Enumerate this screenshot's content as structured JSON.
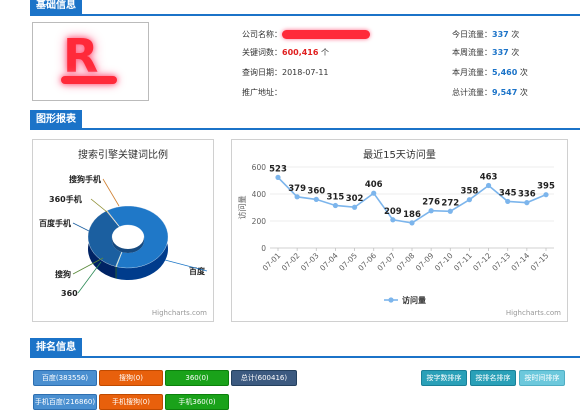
{
  "sections": {
    "basic_info": "基础信息",
    "charts": "图形报表",
    "ranking": "排名信息"
  },
  "info": {
    "company_label": "公司名称：",
    "keyword_label": "关键词数：",
    "keyword_value": "600,416",
    "keyword_unit": " 个",
    "query_date_label": "查询日期：",
    "query_date_value": "2018-07-11",
    "promo_label": "推广地址：",
    "today_label": "今日流量：",
    "today_value": "337",
    "week_label": "本周流量：",
    "week_value": "337",
    "month_label": "本月流量：",
    "month_value": "5,460",
    "total_label": "总计流量：",
    "total_value": "9,547",
    "unit": " 次"
  },
  "pie_panel": {
    "title": "搜索引擎关键词比例",
    "credit": "Highcharts.com"
  },
  "line_panel": {
    "title": "最近15天访问量",
    "credit": "Highcharts.com"
  },
  "chart_data": [
    {
      "type": "pie",
      "title": "搜索引擎关键词比例",
      "categories": [
        "百度",
        "搜狗",
        "360",
        "百度手机",
        "360手机",
        "搜狗手机"
      ],
      "values": [
        383556,
        0,
        0,
        216860,
        0,
        0
      ],
      "colors": [
        "#1f78c8",
        "#5a8a3a",
        "#2e8b57",
        "#1b5fa0",
        "#8a8a2a",
        "#d08030"
      ]
    },
    {
      "type": "line",
      "title": "最近15天访问量",
      "ylabel": "访问量",
      "ylim": [
        0,
        600
      ],
      "yticks": [
        0,
        200,
        400,
        600
      ],
      "grid": true,
      "legend": "bottom",
      "x": [
        "07-01",
        "07-02",
        "07-03",
        "07-04",
        "07-05",
        "07-06",
        "07-07",
        "07-08",
        "07-09",
        "07-10",
        "07-11",
        "07-12",
        "07-13",
        "07-14",
        "07-15"
      ],
      "series": [
        {
          "name": "访问量",
          "color": "#7cb5ec",
          "values": [
            523,
            379,
            360,
            315,
            302,
            406,
            209,
            186,
            276,
            272,
            358,
            463,
            345,
            336,
            395
          ]
        }
      ]
    }
  ],
  "ranking": {
    "buttons": [
      {
        "label": "百度(383556)",
        "style": "blue"
      },
      {
        "label": "搜狗(0)",
        "style": "orange"
      },
      {
        "label": "360(0)",
        "style": "green"
      },
      {
        "label": "总计(600416)",
        "style": "dark"
      },
      {
        "label": "手机百度(216860)",
        "style": "blue"
      },
      {
        "label": "手机搜狗(0)",
        "style": "orange"
      },
      {
        "label": "手机360(0)",
        "style": "green"
      }
    ],
    "sort_buttons": [
      "按字数排序",
      "按排名排序",
      "按时间排序"
    ]
  }
}
